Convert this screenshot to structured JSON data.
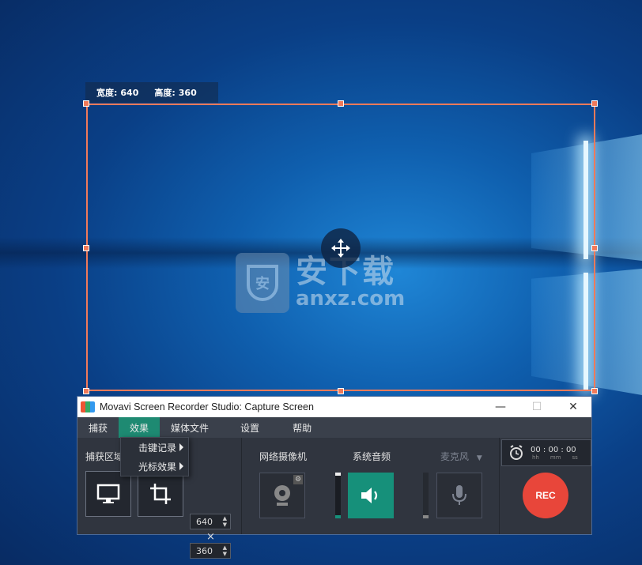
{
  "capture": {
    "width_label": "宽度:",
    "width_value": "640",
    "height_label": "高度:",
    "height_value": "360"
  },
  "watermark": {
    "cn": "安下载",
    "en": "anxz.com",
    "shield": "安"
  },
  "window": {
    "title": "Movavi Screen Recorder Studio: Capture Screen",
    "minimize": "—",
    "maximize": "☐",
    "close": "✕"
  },
  "menu": {
    "items": [
      {
        "label": "捕获"
      },
      {
        "label": "效果"
      },
      {
        "label": "媒体文件"
      },
      {
        "label": "设置"
      },
      {
        "label": "帮助"
      }
    ]
  },
  "effects_popup": {
    "items": [
      {
        "label": "击键记录"
      },
      {
        "label": "光标效果"
      }
    ]
  },
  "panel": {
    "capture_area_label": "捕获区域",
    "width_input": "640",
    "height_input": "360",
    "times_sign": "×",
    "webcam_label": "网络摄像机",
    "system_audio_label": "系统音频",
    "mic_label": "麦克风",
    "timer": {
      "hh": "00",
      "mm": "00",
      "ss": "00",
      "u_hh": "hh",
      "u_mm": "mm",
      "u_ss": "ss"
    },
    "rec_label": "REC"
  },
  "colors": {
    "frame": "#f07a5a",
    "accent": "#1e8a72",
    "rec": "#e8463a"
  }
}
